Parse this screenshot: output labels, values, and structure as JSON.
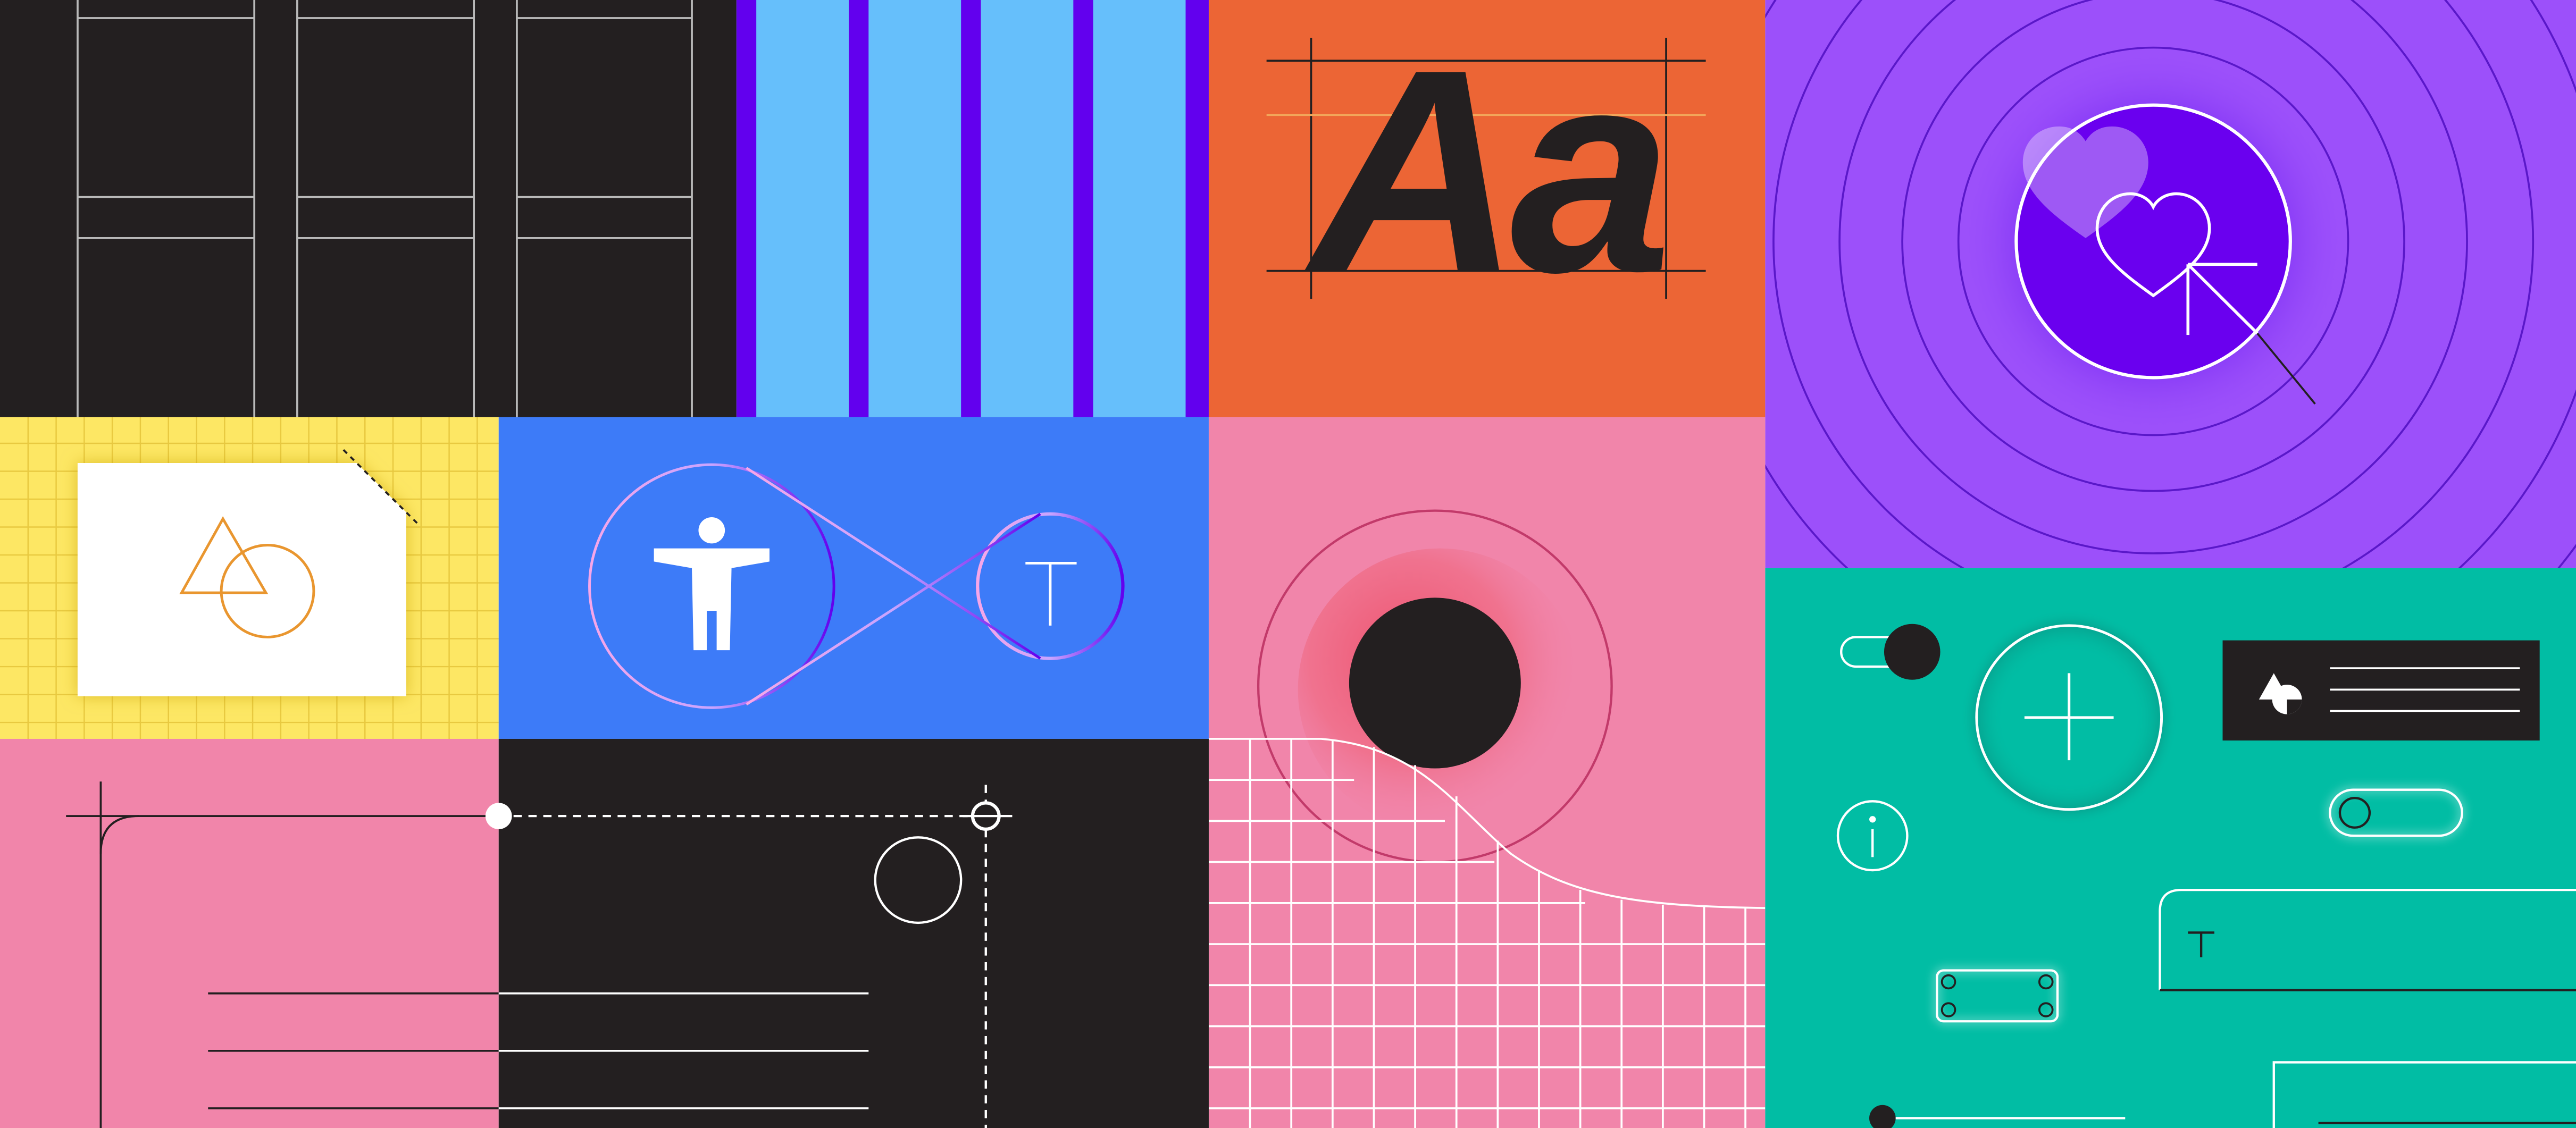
{
  "typography_tile": {
    "specimen_text": "Aa"
  },
  "icons": {
    "accessibility": "accessibility-person-icon",
    "text_tool": "text-tool-icon",
    "shapes": "shapes-icon",
    "heart": "heart-icon",
    "cursor": "cursor-arrow-icon",
    "plus": "plus-icon",
    "info": "info-icon"
  },
  "colors": {
    "dark": "#231f20",
    "light_blue": "#66bffb",
    "violet": "#6200ee",
    "orange": "#ec6535",
    "purple": "#9c50fa",
    "yellow": "#fde764",
    "blue": "#3d7bf8",
    "pink": "#f185aa",
    "teal": "#01bda4",
    "line_orange": "#e9962f"
  }
}
